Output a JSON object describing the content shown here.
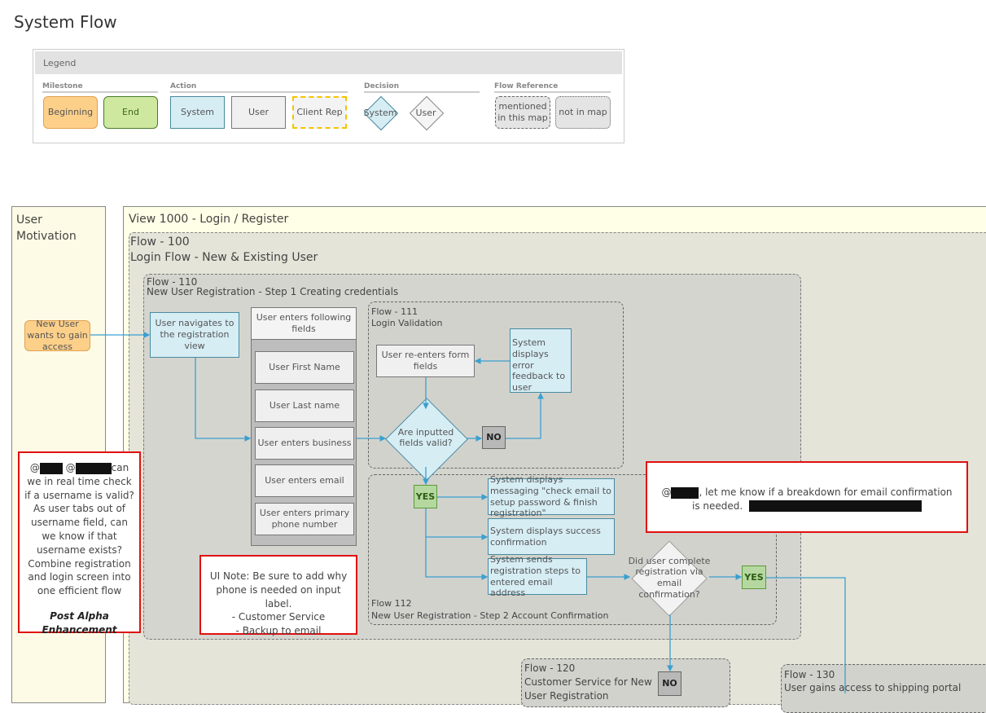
{
  "page": {
    "title": "System Flow"
  },
  "legend": {
    "title": "Legend",
    "sections": {
      "milestone": {
        "label": "Milestone",
        "items": [
          "Beginning",
          "End"
        ]
      },
      "action": {
        "label": "Action",
        "items": [
          "System",
          "User",
          "Client Rep"
        ]
      },
      "decision": {
        "label": "Decision",
        "items": [
          "System",
          "User"
        ]
      },
      "flow_reference": {
        "label": "Flow Reference",
        "items": [
          "mentioned in this map",
          "not in map"
        ]
      }
    }
  },
  "lanes": {
    "user_motivation": "User Motivation",
    "view": "View 1000 - Login / Register"
  },
  "flows": {
    "f100": {
      "id": "Flow - 100",
      "name": "Login Flow - New & Existing User"
    },
    "f110": {
      "id": "Flow - 110",
      "name": "New User Registration - Step 1 Creating credentials"
    },
    "f111": {
      "id": "Flow - 111",
      "name": "Login Validation"
    },
    "f112": {
      "id": "Flow 112",
      "name": "New User Registration - Step 2 Account Confirmation"
    },
    "f120": {
      "id": "Flow - 120",
      "name": "Customer Service for New User Registration"
    },
    "f130": {
      "id": "Flow - 130",
      "name": "User gains access to shipping portal"
    }
  },
  "nodes": {
    "start": "New User wants to gain access",
    "navigate": "User navigates to the registration view",
    "fields_header": "User enters following fields",
    "fields": [
      "User First Name",
      "User Last name",
      "User enters business",
      "User enters email",
      "User enters primary phone number"
    ],
    "reenter": "User re-enters form fields",
    "error_feedback": "System displays error feedback to user",
    "valid_decision": "Are inputted fields valid?",
    "no1": "NO",
    "yes1": "YES",
    "msg_check_email": "System displays messaging \"check email to setup password & finish registration\"",
    "msg_success": "System displays success confirmation",
    "msg_sends": "System sends registration steps to entered email address",
    "complete_decision": "Did user complete registration via email confirmation?",
    "yes2": "YES",
    "no2": "NO"
  },
  "notes": {
    "username_note": {
      "prefix": "@",
      "mid": " @",
      "text": "can we in real time check if a username is valid? As user tabs out of username field, can we know if that username exists?  Combine registration and login screen into one efficient flow",
      "footer": "Post Alpha Enhancement"
    },
    "phone_note": {
      "line1": "UI Note: Be sure to add why phone is needed on input label.",
      "line2": "- Customer Service",
      "line3": "- Backup to email"
    },
    "email_note": {
      "prefix": "@",
      "text": ", let me know if a breakdown for email confirmation is needed."
    }
  },
  "colors": {
    "connector": "#3aa0d0",
    "note_border": "#e01010",
    "system": "#d6edf4",
    "beginning": "#fdd08a",
    "end": "#cfe8a0"
  }
}
